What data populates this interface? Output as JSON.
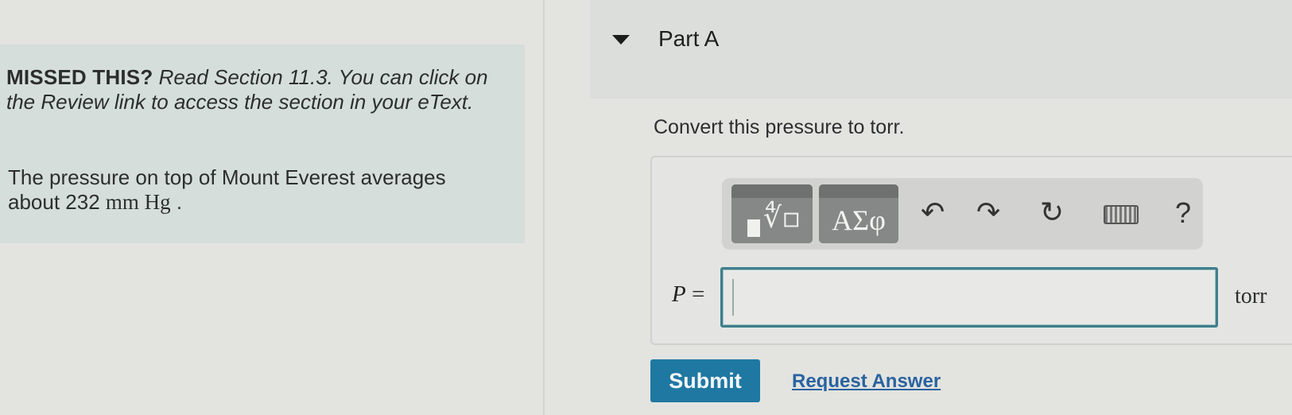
{
  "intro": {
    "missed_label": "MISSED THIS?",
    "missed_text": "Read Section 11.3. You can click on the Review link to access the section in your eText.",
    "problem_text": "The pressure on top of Mount Everest averages about 232",
    "problem_unit": "mm Hg",
    "problem_end": "."
  },
  "part": {
    "title": "Part A",
    "question": "Convert this pressure to torr."
  },
  "toolbar": {
    "templates_icon": "templates-radical-icon",
    "greek_label": "ΑΣφ",
    "undo_icon": "undo-icon",
    "redo_icon": "redo-icon",
    "reset_icon": "reset-icon",
    "keyboard_icon": "keyboard-icon",
    "help_label": "?"
  },
  "answer": {
    "variable": "P",
    "equals": " =",
    "value": "",
    "unit": "torr"
  },
  "actions": {
    "submit_label": "Submit",
    "request_label": "Request Answer"
  },
  "colors": {
    "submit_bg": "#1f78a2",
    "input_border": "#3d7f8c",
    "link": "#2a63a0"
  }
}
